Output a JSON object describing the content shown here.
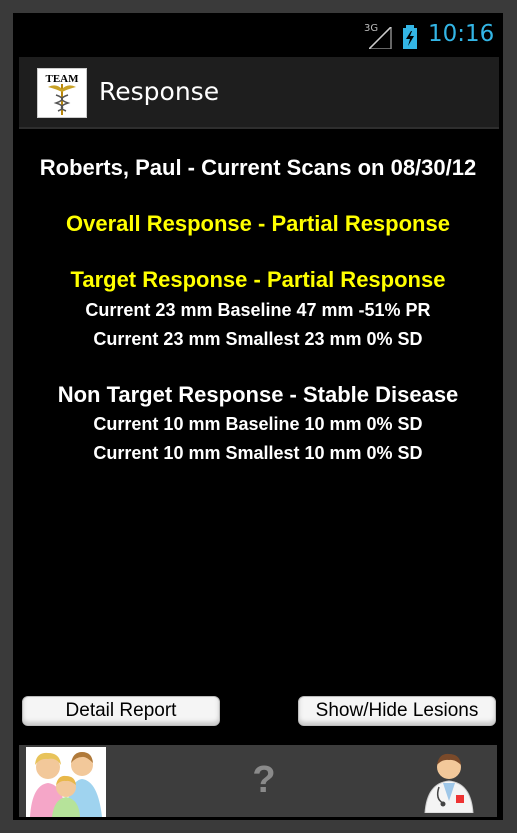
{
  "status_bar": {
    "network": "3G",
    "time": "10:16"
  },
  "action_bar": {
    "logo_text": "TEAM",
    "title": "Response"
  },
  "report": {
    "header": "Roberts, Paul - Current Scans on 08/30/12",
    "overall": "Overall Response - Partial Response",
    "target": {
      "heading": "Target Response - Partial Response",
      "baseline_line": "Current 23 mm Baseline 47 mm -51% PR",
      "smallest_line": "Current 23 mm Smallest 23 mm 0% SD"
    },
    "non_target": {
      "heading": "Non Target Response - Stable Disease",
      "baseline_line": "Current 10 mm Baseline 10 mm 0% SD",
      "smallest_line": "Current 10 mm Smallest 10 mm 0% SD"
    }
  },
  "buttons": {
    "detail_report": "Detail Report",
    "show_hide_lesions": "Show/Hide Lesions"
  },
  "bottom_bar": {
    "help": "?"
  },
  "colors": {
    "highlight": "#ffff00",
    "clock": "#33b5e5"
  },
  "icons": [
    "signal-icon",
    "battery-charging-icon",
    "caduceus-icon",
    "family-icon",
    "help-icon",
    "doctor-icon"
  ]
}
